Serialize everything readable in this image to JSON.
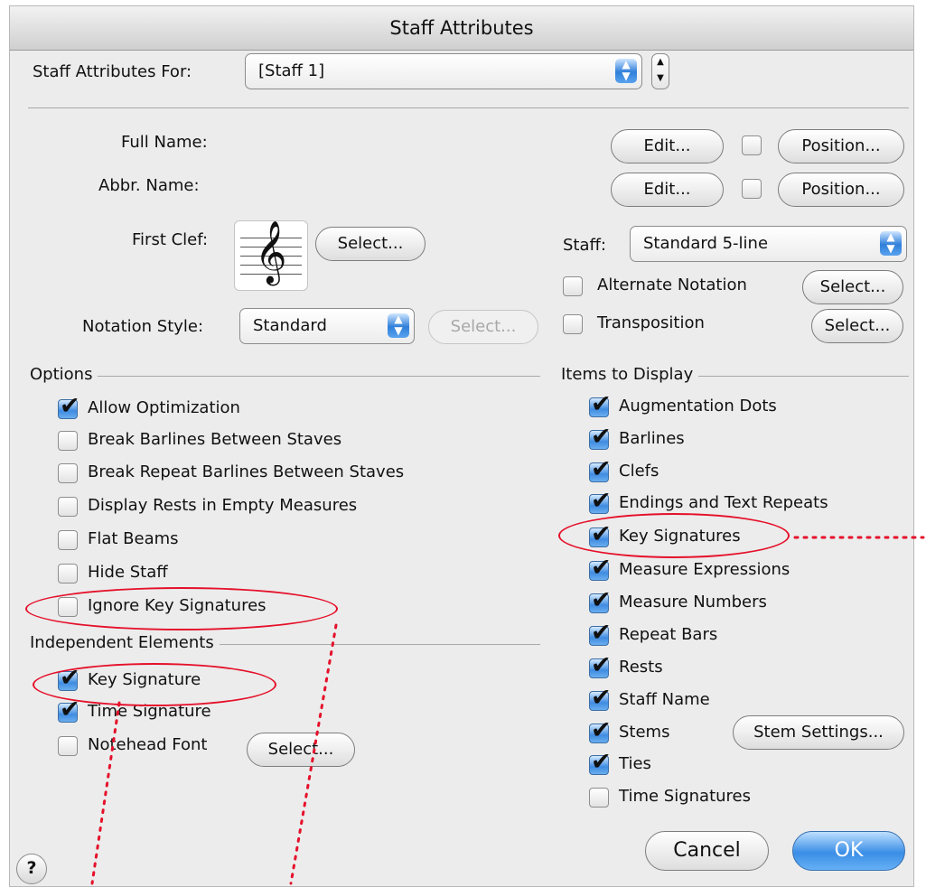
{
  "window": {
    "title": "Staff Attributes"
  },
  "header": {
    "for_label": "Staff Attributes For:",
    "staff_value": "[Staff 1]"
  },
  "names": {
    "full_name_label": "Full Name:",
    "abbr_name_label": "Abbr. Name:",
    "edit_label": "Edit...",
    "position_label": "Position..."
  },
  "clef": {
    "label": "First Clef:",
    "select_label": "Select..."
  },
  "notation": {
    "label": "Notation Style:",
    "value": "Standard",
    "select_label": "Select..."
  },
  "staff": {
    "label": "Staff:",
    "value": "Standard 5-line",
    "alternate_label": "Alternate Notation",
    "transposition_label": "Transposition",
    "select_label": "Select..."
  },
  "options": {
    "title": "Options",
    "items": [
      {
        "label": "Allow Optimization",
        "checked": true
      },
      {
        "label": "Break Barlines Between Staves",
        "checked": false
      },
      {
        "label": "Break Repeat Barlines Between Staves",
        "checked": false
      },
      {
        "label": "Display Rests in Empty Measures",
        "checked": false
      },
      {
        "label": "Flat Beams",
        "checked": false
      },
      {
        "label": "Hide Staff",
        "checked": false
      },
      {
        "label": "Ignore Key Signatures",
        "checked": false
      }
    ]
  },
  "independent": {
    "title": "Independent Elements",
    "items": [
      {
        "label": "Key Signature",
        "checked": true
      },
      {
        "label": "Time Signature",
        "checked": true
      },
      {
        "label": "Notehead Font",
        "checked": false
      }
    ],
    "select_label": "Select..."
  },
  "display": {
    "title": "Items to Display",
    "items": [
      {
        "label": "Augmentation Dots",
        "checked": true
      },
      {
        "label": "Barlines",
        "checked": true
      },
      {
        "label": "Clefs",
        "checked": true
      },
      {
        "label": "Endings and Text Repeats",
        "checked": true
      },
      {
        "label": "Key Signatures",
        "checked": true
      },
      {
        "label": "Measure Expressions",
        "checked": true
      },
      {
        "label": "Measure Numbers",
        "checked": true
      },
      {
        "label": "Repeat Bars",
        "checked": true
      },
      {
        "label": "Rests",
        "checked": true
      },
      {
        "label": "Staff Name",
        "checked": true
      },
      {
        "label": "Stems",
        "checked": true
      },
      {
        "label": "Ties",
        "checked": true
      },
      {
        "label": "Time Signatures",
        "checked": false
      }
    ],
    "stem_settings_label": "Stem Settings..."
  },
  "footer": {
    "help": "?",
    "cancel_label": "Cancel",
    "ok_label": "OK"
  },
  "colors": {
    "annotation": "#e5102a",
    "accent": "#3a8ee6"
  }
}
